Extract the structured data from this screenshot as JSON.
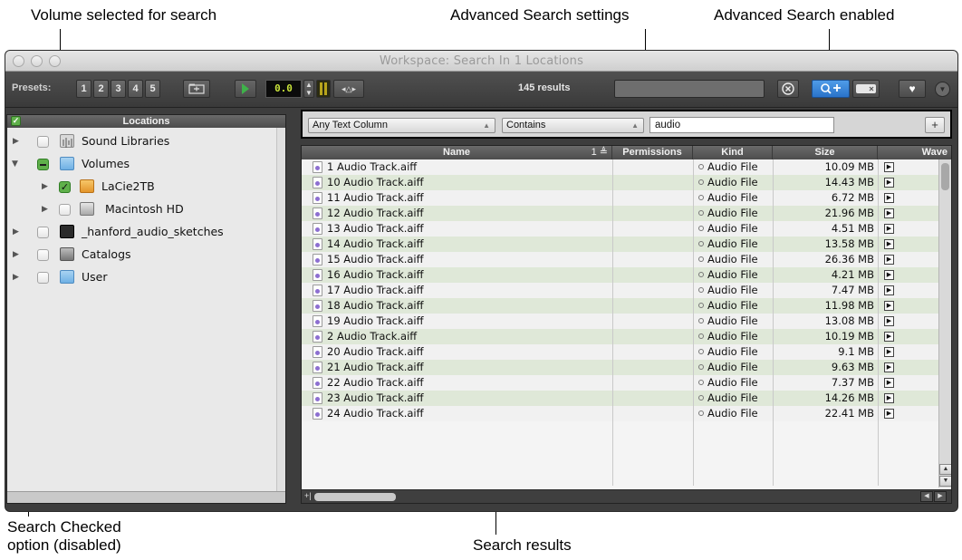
{
  "callouts": {
    "volume_selected": "Volume selected for search",
    "advanced_settings": "Advanced Search settings",
    "advanced_enabled": "Advanced Search enabled",
    "search_checked_line1": "Search Checked",
    "search_checked_line2": "option (disabled)",
    "search_results": "Search results"
  },
  "window": {
    "title": "Workspace: Search In 1 Locations"
  },
  "toolbar": {
    "presets_label": "Presets:",
    "presets": [
      "1",
      "2",
      "3",
      "4",
      "5"
    ],
    "counter_value": "0.0",
    "results_count": "145 results",
    "icons": [
      "folder-icon",
      "play-icon",
      "volume-stepper-icon",
      "meter-icon",
      "pitch-icon",
      "clear-search-icon",
      "advanced-search-icon",
      "toggle-icon",
      "favorite-icon",
      "menu-icon"
    ]
  },
  "locations": {
    "header": "Locations",
    "items": [
      {
        "label": "Sound Libraries",
        "level": 0,
        "expanded": false,
        "checkbox": "unchecked",
        "icon": "sound-library-icon"
      },
      {
        "label": "Volumes",
        "level": 0,
        "expanded": true,
        "checkbox": "mixed",
        "icon": "folder-icon"
      },
      {
        "label": "LaCie2TB",
        "level": 1,
        "expanded": false,
        "checkbox": "checked",
        "icon": "external-drive-icon"
      },
      {
        "label": "Macintosh HD",
        "level": 1,
        "expanded": false,
        "checkbox": "unchecked",
        "icon": "hard-disk-icon"
      },
      {
        "label": "_hanford_audio_sketches",
        "level": 0,
        "expanded": false,
        "checkbox": "unchecked",
        "icon": "session-icon"
      },
      {
        "label": "Catalogs",
        "level": 0,
        "expanded": false,
        "checkbox": "unchecked",
        "icon": "catalog-icon"
      },
      {
        "label": "User",
        "level": 0,
        "expanded": false,
        "checkbox": "unchecked",
        "icon": "folder-icon"
      }
    ]
  },
  "advanced_search": {
    "column_selector": "Any Text Column",
    "operator_selector": "Contains",
    "query": "audio",
    "add_label": "+"
  },
  "results": {
    "columns": {
      "name": "Name",
      "sort_indicator": "1 ≜",
      "permissions": "Permissions",
      "kind": "Kind",
      "size": "Size",
      "wave": "Wave"
    },
    "rows": [
      {
        "name": "1 Audio Track.aiff",
        "kind": "Audio File",
        "size": "10.09 MB"
      },
      {
        "name": "10 Audio Track.aiff",
        "kind": "Audio File",
        "size": "14.43 MB"
      },
      {
        "name": "11 Audio Track.aiff",
        "kind": "Audio File",
        "size": "6.72 MB"
      },
      {
        "name": "12 Audio Track.aiff",
        "kind": "Audio File",
        "size": "21.96 MB"
      },
      {
        "name": "13 Audio Track.aiff",
        "kind": "Audio File",
        "size": "4.51 MB"
      },
      {
        "name": "14 Audio Track.aiff",
        "kind": "Audio File",
        "size": "13.58 MB"
      },
      {
        "name": "15 Audio Track.aiff",
        "kind": "Audio File",
        "size": "26.36 MB"
      },
      {
        "name": "16 Audio Track.aiff",
        "kind": "Audio File",
        "size": "4.21 MB"
      },
      {
        "name": "17 Audio Track.aiff",
        "kind": "Audio File",
        "size": "7.47 MB"
      },
      {
        "name": "18 Audio Track.aiff",
        "kind": "Audio File",
        "size": "11.98 MB"
      },
      {
        "name": "19 Audio Track.aiff",
        "kind": "Audio File",
        "size": "13.08 MB"
      },
      {
        "name": "2 Audio Track.aiff",
        "kind": "Audio File",
        "size": "10.19 MB"
      },
      {
        "name": "20 Audio Track.aiff",
        "kind": "Audio File",
        "size": "9.1 MB"
      },
      {
        "name": "21 Audio Track.aiff",
        "kind": "Audio File",
        "size": "9.63 MB"
      },
      {
        "name": "22 Audio Track.aiff",
        "kind": "Audio File",
        "size": "7.37 MB"
      },
      {
        "name": "23 Audio Track.aiff",
        "kind": "Audio File",
        "size": "14.26 MB"
      },
      {
        "name": "24 Audio Track.aiff",
        "kind": "Audio File",
        "size": "22.41 MB"
      }
    ]
  },
  "colors": {
    "row_alt": "#dfe8d8",
    "row_base": "#f1f1f1",
    "checkbox_green": "#5fb04a",
    "advanced_active": "#2f7fd8"
  }
}
